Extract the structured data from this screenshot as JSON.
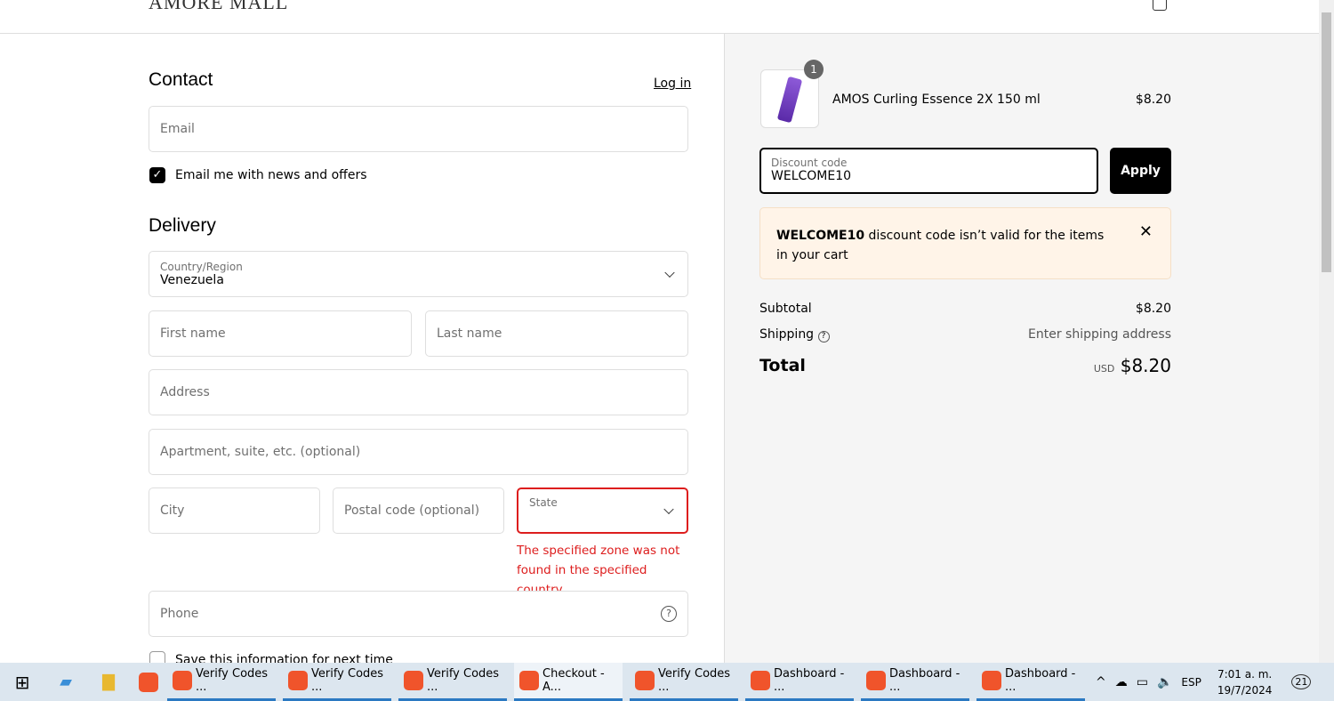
{
  "header": {
    "logo": "AMORE MALL"
  },
  "contact": {
    "title": "Contact",
    "login": "Log in",
    "email_placeholder": "Email",
    "newsletter_label": "Email me with news and offers",
    "newsletter_checked": true
  },
  "delivery": {
    "title": "Delivery",
    "country_label": "Country/Region",
    "country_value": "Venezuela",
    "first_name": "First name",
    "last_name": "Last name",
    "address": "Address",
    "apartment": "Apartment, suite, etc. (optional)",
    "city": "City",
    "postal": "Postal code (optional)",
    "state_label": "State",
    "state_error": "The specified zone was not found in the specified country.",
    "phone": "Phone",
    "save_info": "Save this information for next time"
  },
  "summary": {
    "item": {
      "qty": "1",
      "name": "AMOS Curling Essence 2X 150 ml",
      "price": "$8.20"
    },
    "discount_label": "Discount code",
    "discount_value": "WELCOME10",
    "apply": "Apply",
    "notice_code": "WELCOME10",
    "notice_text": " discount code isn’t valid for the items in your cart",
    "subtotal_label": "Subtotal",
    "subtotal": "$8.20",
    "shipping_label": "Shipping",
    "shipping": "Enter shipping address",
    "total_label": "Total",
    "currency": "USD",
    "total": "$8.20"
  },
  "colors": {
    "error": "#dd1d1d",
    "notice_bg": "#fff4e8",
    "button": "#000000"
  },
  "taskbar": {
    "items": [
      "Verify Codes ...",
      "Verify Codes ...",
      "Verify Codes ...",
      "Checkout - A...",
      "Verify Codes ...",
      "Dashboard - ...",
      "Dashboard - ...",
      "Dashboard - ..."
    ],
    "lang": "ESP",
    "time": "7:01 a. m.",
    "date": "19/7/2024",
    "notifications": "21"
  }
}
